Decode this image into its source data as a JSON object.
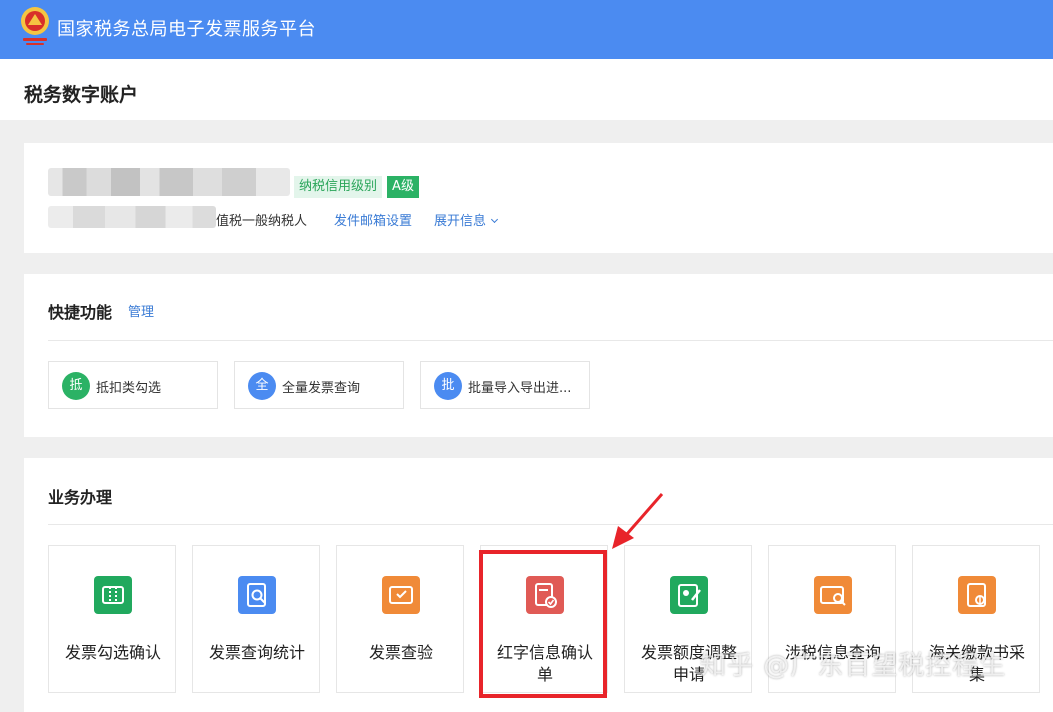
{
  "header": {
    "platform_title": "国家税务总局电子发票服务平台",
    "emblem_icon": "tax-emblem-icon",
    "bg_color": "#4b8bf1"
  },
  "page": {
    "title": "税务数字账户"
  },
  "account": {
    "credit_label": "纳税信用级别",
    "credit_grade": "A级",
    "taxpayer_type": "值税一般纳税人",
    "email_settings": "发件邮箱设置",
    "expand_info": "展开信息"
  },
  "quick": {
    "title": "快捷功能",
    "manage": "管理",
    "items": [
      {
        "badge": "抵",
        "label": "抵扣类勾选",
        "color": "#2bb265"
      },
      {
        "badge": "全",
        "label": "全量发票查询",
        "color": "#4b8bf1"
      },
      {
        "badge": "批",
        "label": "批量导入导出进...",
        "color": "#4b8bf1"
      }
    ]
  },
  "business": {
    "title": "业务办理",
    "tiles": [
      {
        "label": "发票勾选确认",
        "icon": "invoice-check-icon",
        "color": "#21a95e"
      },
      {
        "label": "发票查询统计",
        "icon": "invoice-search-icon",
        "color": "#4b8bf1"
      },
      {
        "label": "发票查验",
        "icon": "invoice-verify-icon",
        "color": "#f08a38"
      },
      {
        "label": "红字信息确认\n单",
        "icon": "red-invoice-confirm-icon",
        "color": "#e05a55"
      },
      {
        "label": "发票额度调整\n申请",
        "icon": "quota-adjust-icon",
        "color": "#21a95e"
      },
      {
        "label": "涉税信息查询",
        "icon": "tax-info-search-icon",
        "color": "#f08a38"
      },
      {
        "label": "海关缴款书采\n集",
        "icon": "customs-payment-icon",
        "color": "#f08a38"
      }
    ]
  },
  "annotation": {
    "highlight_color": "#e8242a"
  },
  "watermark": "知乎 @广东百望税控程生"
}
